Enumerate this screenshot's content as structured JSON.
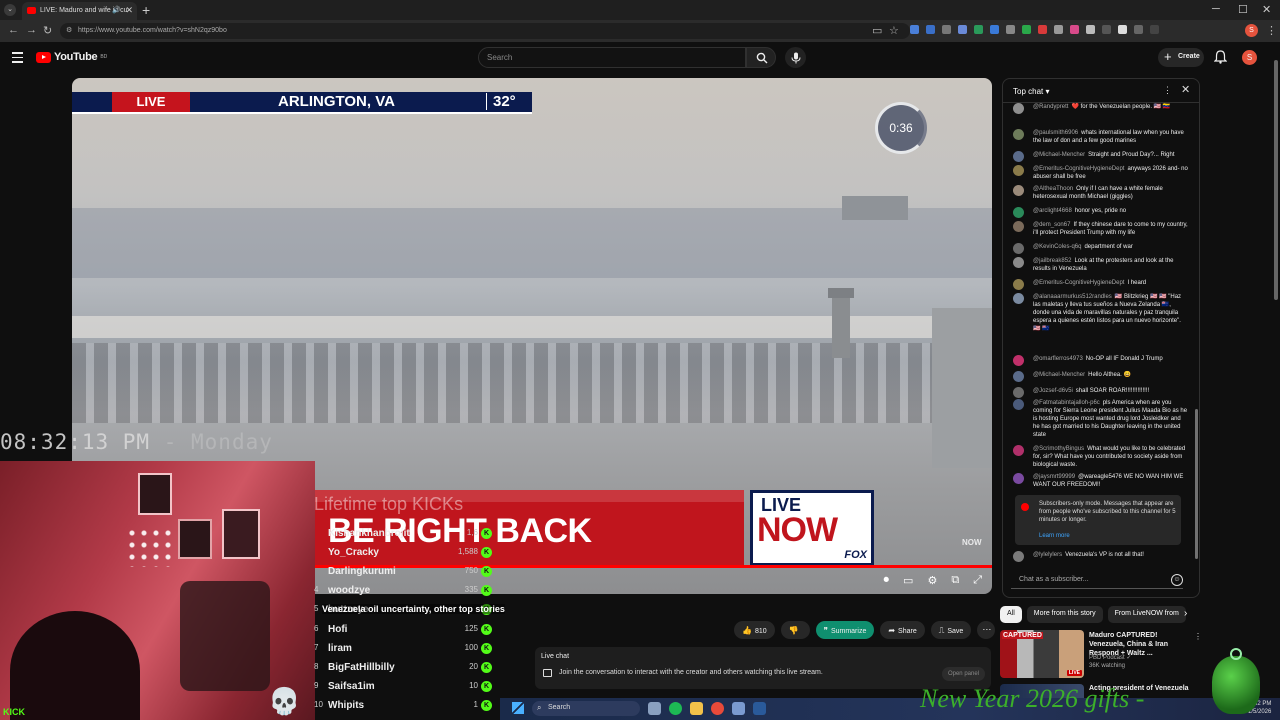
{
  "browser": {
    "tab_title": "LIVE: Maduro and wife in cu",
    "url": "https://www.youtube.com/watch?v=shN2qz90bo",
    "new_tab": "+",
    "profile_initial": "S"
  },
  "yt": {
    "logo_word": "YouTube",
    "country": "BD",
    "search_placeholder": "Search",
    "create_label": "Create",
    "avatar_initial": "S"
  },
  "player": {
    "live_badge": "LIVE",
    "location": "ARLINGTON, VA",
    "temperature": "32°",
    "countdown": "0:36",
    "brb": "BE RIGHT BACK",
    "now_live": "LIVE",
    "now_now": "NOW",
    "now_fox": "FOX",
    "watermark": "NOW",
    "progress_fraction": 1.0
  },
  "overlay": {
    "clock_time": "08:32:13 PM",
    "clock_day": "- Monday",
    "platform_tag": "KICK",
    "leaderboard_title": "Lifetime top KICKs",
    "leaderboard": [
      {
        "rank": "",
        "name": "Kishankhanbrojit",
        "count": "1,6"
      },
      {
        "rank": "",
        "name": "Yo_Cracky",
        "count": "1,588"
      },
      {
        "rank": "",
        "name": "Darlingkurumi",
        "count": "750"
      },
      {
        "rank": "4",
        "name": "woodzye",
        "count": "335"
      },
      {
        "rank": "5",
        "name": "buttzeye",
        "count": ""
      },
      {
        "rank": "6",
        "name": "Hofi",
        "count": "125"
      },
      {
        "rank": "7",
        "name": "liram",
        "count": "100"
      },
      {
        "rank": "8",
        "name": "BigFatHillbilly",
        "count": "20"
      },
      {
        "rank": "9",
        "name": "Saifsa1im",
        "count": "10"
      },
      {
        "rank": "10",
        "name": "Whipits",
        "count": "1"
      }
    ],
    "video_caption": "Venezuela oil uncertainty, other top stories",
    "promo_text": "New Year 2026 gifts -"
  },
  "actions": {
    "likes": "810",
    "summarize": "Summarize",
    "share": "Share",
    "save": "Save"
  },
  "live_chat_prompt": {
    "title": "Live chat",
    "text": "Join the conversation to interact with the creator and others watching this live stream.",
    "open_button": "Open panel"
  },
  "chat": {
    "title": "Top chat",
    "messages": [
      {
        "user": "@Randyprett",
        "text": "❤️ for the Venezuelan people. 🇺🇸 🇻🇪",
        "color": "#8e8e8e"
      },
      {
        "user": "@paulsmith6906",
        "text": "whats international law when you have the law of don and a few good marines",
        "color": "#6d7b5a"
      },
      {
        "user": "@Michael-Mencher",
        "text": "Straight and Proud Day?... Right",
        "color": "#5a6b8a"
      },
      {
        "user": "@Emeritus-CognitiveHygieneDept",
        "text": "anyways 2026 and- no abuser shall be free",
        "color": "#8a7b4a"
      },
      {
        "user": "@AltheaThoon",
        "text": "Only if I can have a white female heterosexual month Michael (giggles)",
        "color": "#9a8a7a"
      },
      {
        "user": "@arclight4668",
        "text": "honor yes, pride no",
        "color": "#2a8a5a"
      },
      {
        "user": "@dem_son67",
        "text": "If they chinese dare to come to my country, i'll protect President Trump with my life",
        "color": "#7a6a5a"
      },
      {
        "user": "@KevinColes-q6q",
        "text": "department of war",
        "color": "#6a6a6a"
      },
      {
        "user": "@jailbreak852",
        "text": "Look at the protesters and look at the results in Venezuela",
        "color": "#8a8a8a"
      },
      {
        "user": "@Emeritus-CognitiveHygieneDept",
        "text": "I heard",
        "color": "#8a7b4a"
      },
      {
        "user": "@alanaaarmurkus512randles",
        "text": "🇺🇸 Blitzkrieg 🇺🇸 🇺🇸 \"Haz las maletas y lleva tus sueños a Nueva Zelanda 🇳🇿, donde una vida de maravillas naturales y paz tranquila espera a quienes estén listos para un nuevo horizonte\". 🇺🇸 🇳🇿",
        "color": "#7a8aa0"
      },
      {
        "user": "@omarflerros4973",
        "text": "No-OP all IF Donald J Trump",
        "color": "#c0306a"
      },
      {
        "user": "@Michael-Mencher",
        "text": "Hello Althea. 😀",
        "color": "#5a6b8a"
      },
      {
        "user": "@Jozsef-d6v5i",
        "text": "shall SOAR ROAR!!!!!!!!!!!!!!",
        "color": "#6a6a6a"
      },
      {
        "user": "@Fatmatabintajalloh-p6c",
        "text": "pls America when are you coming for Sierra Leone president Julius Maada Bio as he is hosting Europe most wanted drug lord Josleidker and he has got married to his Daughter leaving in the united state",
        "color": "#4a5a7a"
      },
      {
        "user": "@ScrimothyBingus",
        "text": "What would you like to be celebrated for, sir? What have you contributed to society aside from biological waste.",
        "color": "#b0306a"
      },
      {
        "user": "@jaysmrt99999",
        "text": "@wareagle5476 WE NO WAN HIM WE WANT OUR FREEDOM!!",
        "color": "#7a4aa0"
      },
      {
        "user": "@lylelylers",
        "text": "Venezuela's VP is not all that!",
        "color": "#7a7a7a"
      }
    ],
    "sub_mode_text": "Subscribers-only mode. Messages that appear are from people who've subscribed to this channel for 5 minutes or longer.",
    "learn_more": "Learn more",
    "input_placeholder": "Chat as a subscriber..."
  },
  "chips": [
    "All",
    "More from this story",
    "From LiveNOW from"
  ],
  "recommendations": [
    {
      "title": "Maduro CAPTURED! Venezuela, China & Iran Respond + Waltz ...",
      "channel": "PBD Podcast",
      "views": "36K watching",
      "thumb_caption": "CAPTURED",
      "thumb_badge": "LIVE"
    },
    {
      "title": "Acting president of Venezuela"
    }
  ],
  "taskbar": {
    "search_label": "Search",
    "time": "8:32 PM",
    "date": "1/5/2026"
  }
}
